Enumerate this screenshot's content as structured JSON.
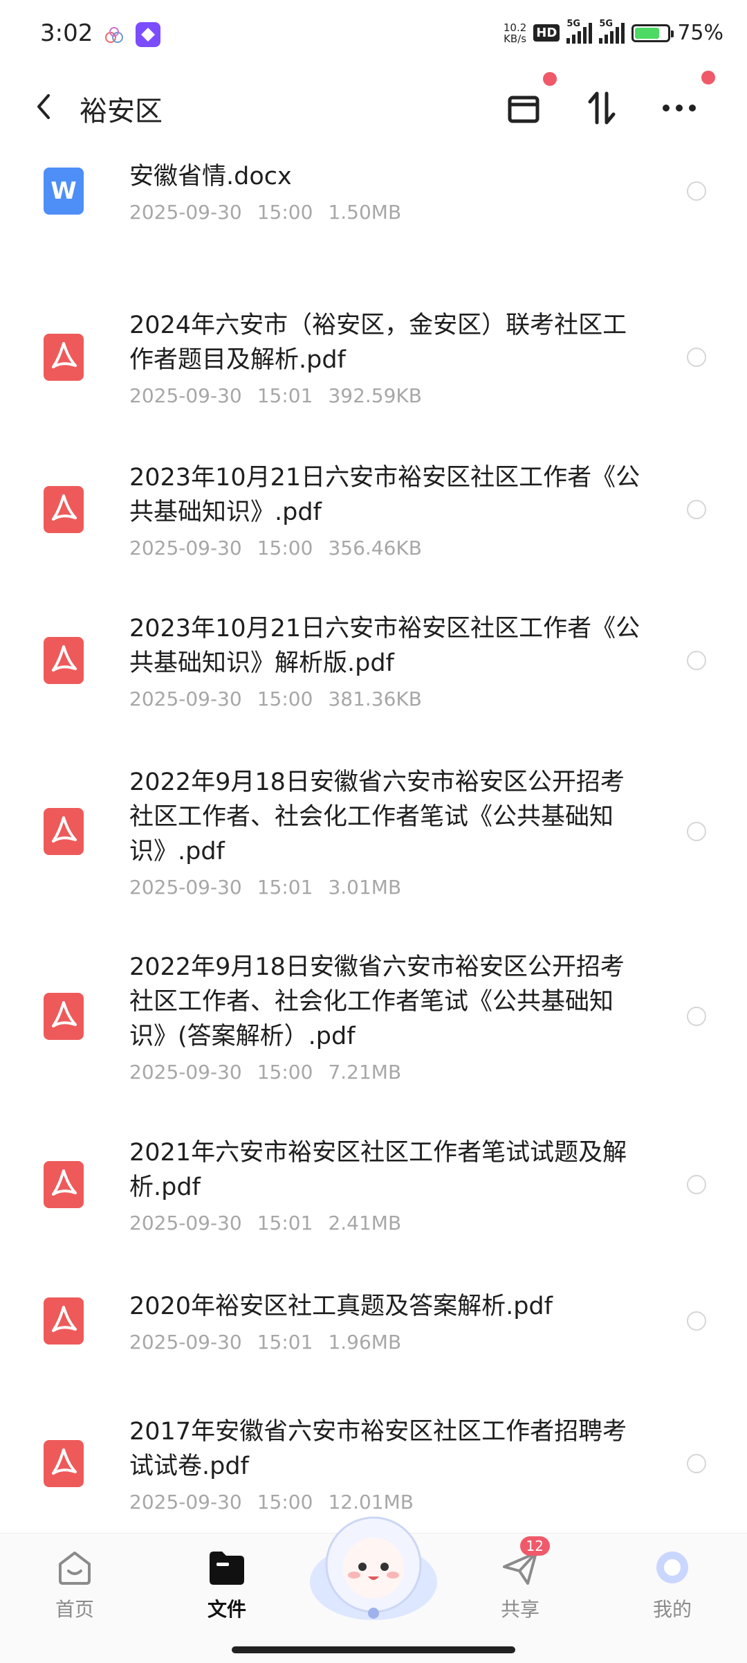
{
  "status_bar": {
    "time": "3:02",
    "net_speed_value": "10.2",
    "net_speed_unit": "KB/s",
    "hd_label": "HD",
    "signal1_label": "5G",
    "signal2_label": "5G",
    "battery_percent": "75%",
    "battery_level": 0.75
  },
  "header": {
    "title": "裕安区",
    "icons": [
      "back-icon",
      "archive-icon",
      "sort-icon",
      "more-icon"
    ]
  },
  "files": [
    {
      "name": "安徽省情.docx",
      "date": "2025-09-30",
      "time": "15:00",
      "size": "1.50MB",
      "type": "doc",
      "icon_glyph": "W"
    },
    {
      "name": "2024年六安市（裕安区，金安区）联考社区工作者题目及解析.pdf",
      "date": "2025-09-30",
      "time": "15:01",
      "size": "392.59KB",
      "type": "pdf"
    },
    {
      "name": "2023年10月21日六安市裕安区社区工作者《公共基础知识》.pdf",
      "date": "2025-09-30",
      "time": "15:00",
      "size": "356.46KB",
      "type": "pdf"
    },
    {
      "name": "2023年10月21日六安市裕安区社区工作者《公共基础知识》解析版.pdf",
      "date": "2025-09-30",
      "time": "15:00",
      "size": "381.36KB",
      "type": "pdf"
    },
    {
      "name": "2022年9月18日安徽省六安市裕安区公开招考社区工作者、社会化工作者笔试《公共基础知识》.pdf",
      "date": "2025-09-30",
      "time": "15:01",
      "size": "3.01MB",
      "type": "pdf"
    },
    {
      "name": "2022年9月18日安徽省六安市裕安区公开招考社区工作者、社会化工作者笔试《公共基础知识》(答案解析）.pdf",
      "date": "2025-09-30",
      "time": "15:00",
      "size": "7.21MB",
      "type": "pdf"
    },
    {
      "name": "2021年六安市裕安区社区工作者笔试试题及解析.pdf",
      "date": "2025-09-30",
      "time": "15:01",
      "size": "2.41MB",
      "type": "pdf"
    },
    {
      "name": "2020年裕安区社工真题及答案解析.pdf",
      "date": "2025-09-30",
      "time": "15:01",
      "size": "1.96MB",
      "type": "pdf"
    },
    {
      "name": "2017年安徽省六安市裕安区社区工作者招聘考试试卷.pdf",
      "date": "2025-09-30",
      "time": "15:00",
      "size": "12.01MB",
      "type": "pdf"
    }
  ],
  "bottom_nav": {
    "items": [
      {
        "label": "首页",
        "icon": "home-icon",
        "active": false
      },
      {
        "label": "文件",
        "icon": "folder-icon",
        "active": true
      },
      {
        "label": "共享",
        "icon": "share-icon",
        "active": false,
        "badge": "12"
      },
      {
        "label": "我的",
        "icon": "profile-icon",
        "active": false
      }
    ],
    "center": "mascot-icon"
  },
  "colors": {
    "pdf_icon": "#ee5a5a",
    "doc_icon": "#4e8ef7",
    "notification_dot": "#f0596a",
    "meta_text": "#a7a7a7"
  }
}
